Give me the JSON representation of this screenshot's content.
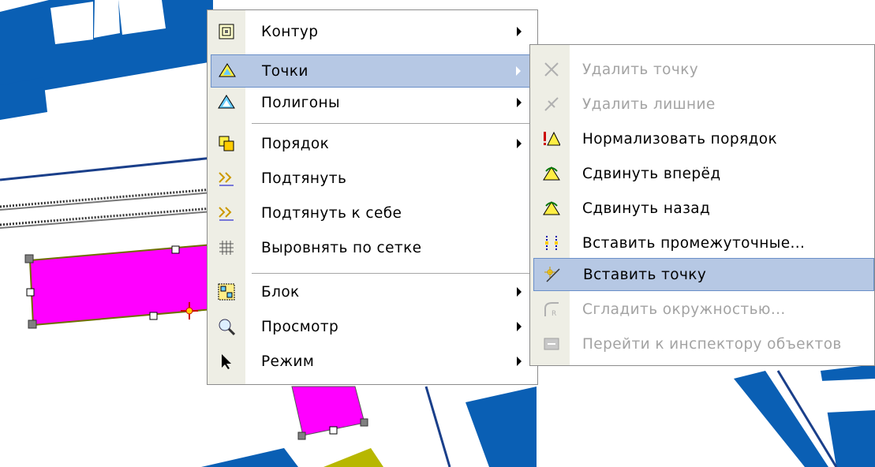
{
  "colors": {
    "blue": "#0a5fb4",
    "magenta": "#ff00ff",
    "olive": "#b7b700",
    "gutter": "#eeeee5",
    "highlight": "#b6c8e4",
    "disabled_text": "#a3a3a3"
  },
  "main_menu": {
    "items": [
      {
        "label": "Контур",
        "icon": "contour-icon",
        "submenu": true
      },
      {
        "label": "Точки",
        "icon": "points-icon",
        "submenu": true,
        "highlighted": true
      },
      {
        "label": "Полигоны",
        "icon": "polygons-icon",
        "submenu": true
      },
      {
        "label": "Порядок",
        "icon": "order-icon",
        "submenu": true
      },
      {
        "label": "Подтянуть",
        "icon": "snap-icon"
      },
      {
        "label": "Подтянуть к себе",
        "icon": "snap-to-self-icon"
      },
      {
        "label": "Выровнять по сетке",
        "icon": "grid-icon"
      },
      {
        "label": "Блок",
        "icon": "block-icon",
        "submenu": true
      },
      {
        "label": "Просмотр",
        "icon": "magnifier-icon",
        "submenu": true
      },
      {
        "label": "Режим",
        "icon": "cursor-arrow-icon",
        "submenu": true
      }
    ]
  },
  "points_submenu": {
    "items": [
      {
        "label": "Удалить точку",
        "icon": "delete-point-icon",
        "disabled": true
      },
      {
        "label": "Удалить лишние",
        "icon": "delete-extra-icon",
        "disabled": true
      },
      {
        "label": "Нормализовать порядок",
        "icon": "normalize-order-icon"
      },
      {
        "label": "Сдвинуть вперёд",
        "icon": "shift-forward-icon"
      },
      {
        "label": "Сдвинуть назад",
        "icon": "shift-back-icon"
      },
      {
        "label": "Вставить промежуточные...",
        "icon": "insert-intermediate-icon"
      },
      {
        "label": "Вставить точку",
        "icon": "insert-point-icon",
        "highlighted": true
      },
      {
        "label": "Сгладить окружностью...",
        "icon": "smooth-circle-icon",
        "disabled": true
      },
      {
        "label": "Перейти к инспектору объектов",
        "icon": "object-inspector-icon",
        "disabled": true
      }
    ]
  }
}
